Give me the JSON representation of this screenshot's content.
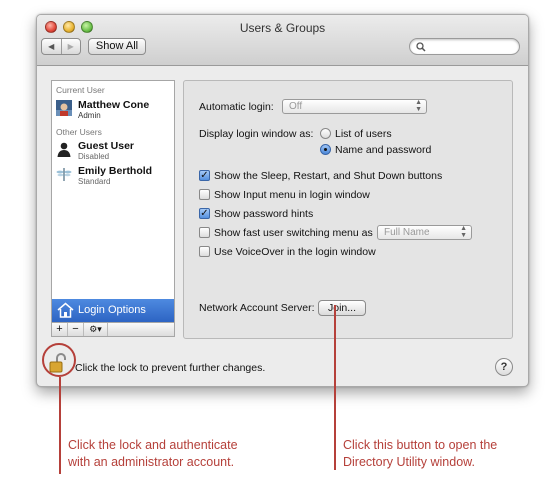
{
  "window": {
    "title": "Users & Groups",
    "nav_back": "◀",
    "nav_forward": "▶",
    "show_all_label": "Show All",
    "search_placeholder": ""
  },
  "sidebar": {
    "current_user_header": "Current User",
    "current_user": {
      "name": "Matthew Cone",
      "role": "Admin"
    },
    "other_users_header": "Other Users",
    "other_users": [
      {
        "name": "Guest User",
        "role": "Disabled"
      },
      {
        "name": "Emily Berthold",
        "role": "Standard"
      }
    ],
    "login_options_label": "Login Options",
    "add_label": "+",
    "remove_label": "−",
    "action_label": "⚙▾"
  },
  "panel": {
    "automatic_login_label": "Automatic login:",
    "automatic_login_value": "Off",
    "display_login_label": "Display login window as:",
    "display_login_options": [
      {
        "label": "List of users",
        "selected": false
      },
      {
        "label": "Name and password",
        "selected": true
      }
    ],
    "checkboxes": [
      {
        "label": "Show the Sleep, Restart, and Shut Down buttons",
        "checked": true
      },
      {
        "label": "Show Input menu in login window",
        "checked": false
      },
      {
        "label": "Show password hints",
        "checked": true
      },
      {
        "label": "Show fast user switching menu as",
        "checked": false
      },
      {
        "label": "Use VoiceOver in the login window",
        "checked": false
      }
    ],
    "fast_switch_value": "Full Name",
    "network_label": "Network Account Server:",
    "join_label": "Join..."
  },
  "footer": {
    "lock_text": "Click the lock to prevent further changes.",
    "help_label": "?"
  },
  "callouts": {
    "left_line1": "Click the lock and authenticate",
    "left_line2": "with an administrator account.",
    "right_line1": "Click this button to open the",
    "right_line2": "Directory Utility window."
  },
  "colors": {
    "callout": "#b5403a",
    "selection": "#2d64c3"
  }
}
